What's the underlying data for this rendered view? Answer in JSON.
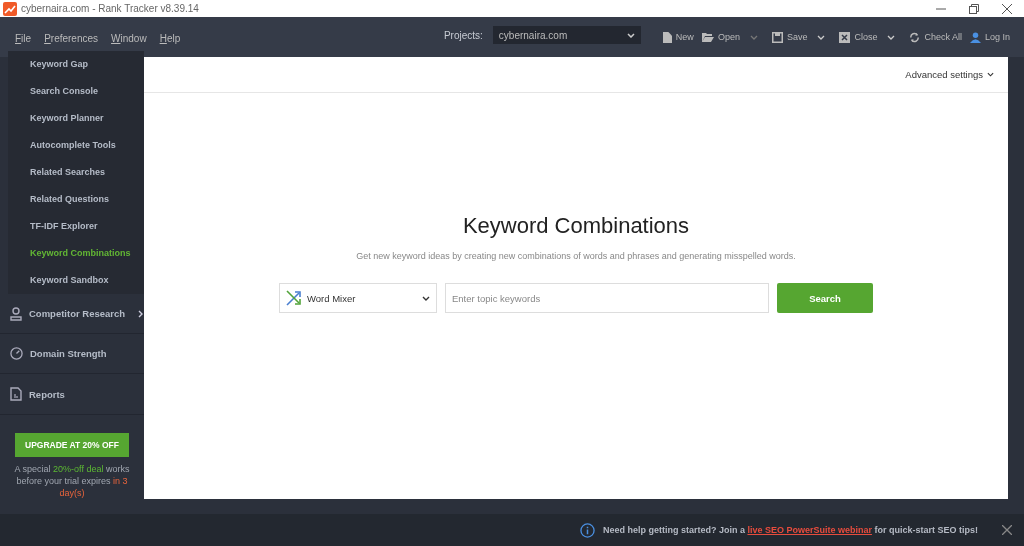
{
  "window": {
    "title": "cybernaira.com - Rank Tracker v8.39.14"
  },
  "menu": [
    "File",
    "Preferences",
    "Window",
    "Help"
  ],
  "projects": {
    "label": "Projects:",
    "value": "cybernaira.com"
  },
  "toolbar": [
    {
      "label": "New",
      "kind": "new",
      "has_menu": false
    },
    {
      "label": "Open",
      "kind": "open",
      "has_menu": true
    },
    {
      "label": "Save",
      "kind": "save",
      "has_menu": true
    },
    {
      "label": "Close",
      "kind": "close",
      "has_menu": true
    },
    {
      "label": "Check All",
      "kind": "refresh",
      "has_menu": false
    },
    {
      "label": "Log In",
      "kind": "user",
      "has_menu": false
    }
  ],
  "sidebar": {
    "items": [
      {
        "label": "Keyword Gap",
        "selected": false
      },
      {
        "label": "Search Console",
        "selected": false
      },
      {
        "label": "Keyword Planner",
        "selected": false
      },
      {
        "label": "Autocomplete Tools",
        "selected": false
      },
      {
        "label": "Related Searches",
        "selected": false
      },
      {
        "label": "Related Questions",
        "selected": false
      },
      {
        "label": "TF-IDF Explorer",
        "selected": false
      },
      {
        "label": "Keyword Combinations",
        "selected": true
      },
      {
        "label": "Keyword Sandbox",
        "selected": false
      }
    ],
    "sections": [
      {
        "label": "Competitor Research",
        "kind": "person",
        "expandable": true
      },
      {
        "label": "Domain Strength",
        "kind": "gauge",
        "expandable": false
      },
      {
        "label": "Reports",
        "kind": "report",
        "expandable": false
      }
    ],
    "upgrade_button": "UPGRADE AT 20% OFF",
    "promo": [
      {
        "text": "A special ",
        "kind": "plain"
      },
      {
        "text": "20%-off deal",
        "kind": "highlight"
      },
      {
        "text": " works before your trial expires ",
        "kind": "plain"
      },
      {
        "text": "in 3 day(s)",
        "kind": "warning"
      }
    ]
  },
  "main": {
    "advanced_settings": "Advanced settings",
    "title": "Keyword Combinations",
    "subtitle": "Get new keyword ideas by creating new combinations of words and phrases and generating misspelled words.",
    "mode": "Word Mixer",
    "search": {
      "placeholder": "Enter topic keywords"
    },
    "search_button": "Search"
  },
  "notification": [
    {
      "text": "Need help getting started? Join a ",
      "kind": "plain"
    },
    {
      "text": "live SEO PowerSuite webinar",
      "kind": "link"
    },
    {
      "text": " for quick-start SEO tips!",
      "kind": "plain"
    }
  ]
}
